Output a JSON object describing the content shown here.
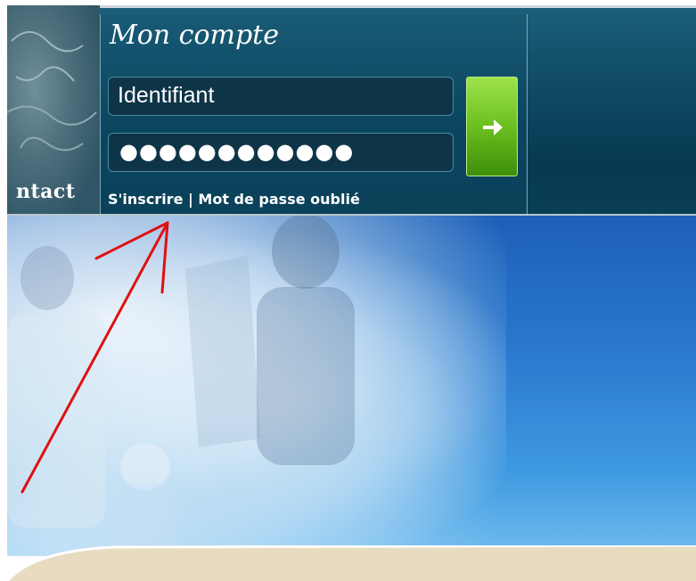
{
  "header": {
    "nav_partial": "ntact"
  },
  "account": {
    "title": "Mon compte",
    "login_value": "Identifiant",
    "password_masked": "●●●●●●●●●●●●",
    "submit_icon": "arrow-right-icon",
    "register_link": "S'inscrire",
    "separator": "|",
    "forgot_link": "Mot de passe oublié"
  },
  "colors": {
    "header_bg": "#0b4560",
    "button_green": "#6bbf1f",
    "annotation_red": "#e01010"
  }
}
